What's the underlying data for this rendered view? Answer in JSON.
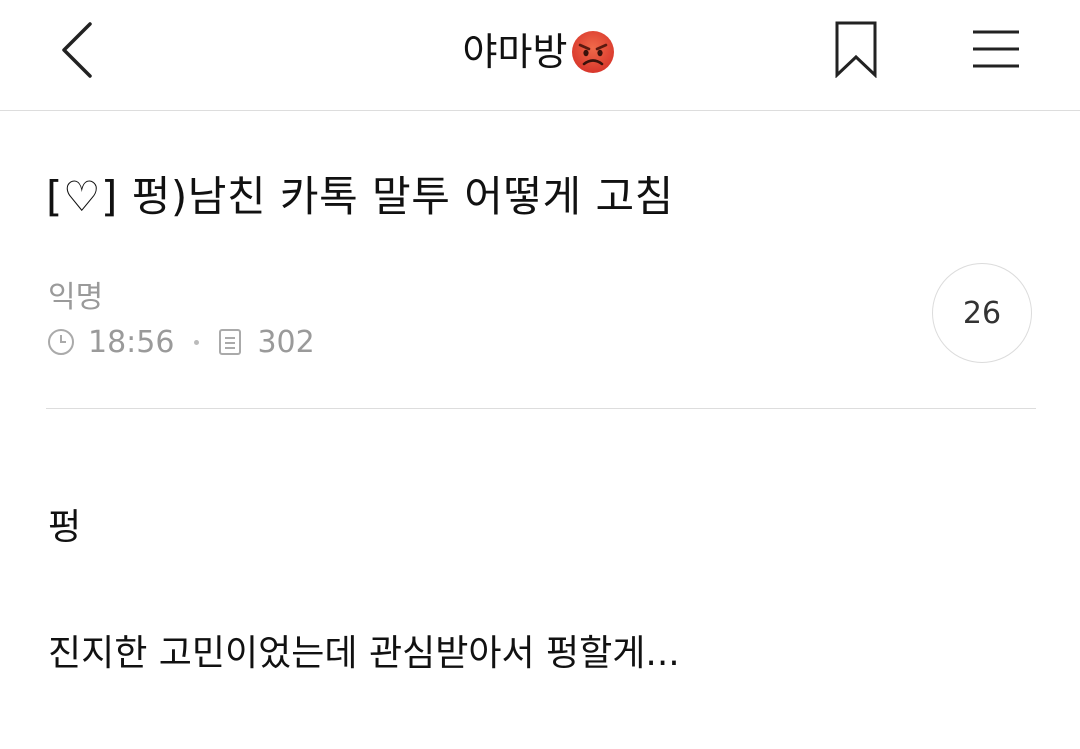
{
  "header": {
    "board_name": "야마방",
    "emoji": "angry-face"
  },
  "post": {
    "title": "[♡] 펑)남친 카톡 말투 어떻게 고침",
    "author": "익명",
    "time": "18:56",
    "views": "302",
    "comment_count": "26",
    "body_lines": [
      "펑",
      "진지한 고민이었는데 관심받아서 펑할게..."
    ]
  },
  "colors": {
    "text": "#111111",
    "meta": "#9a9a9a",
    "divider": "#dddddd",
    "emoji_red": "#e5483b"
  }
}
